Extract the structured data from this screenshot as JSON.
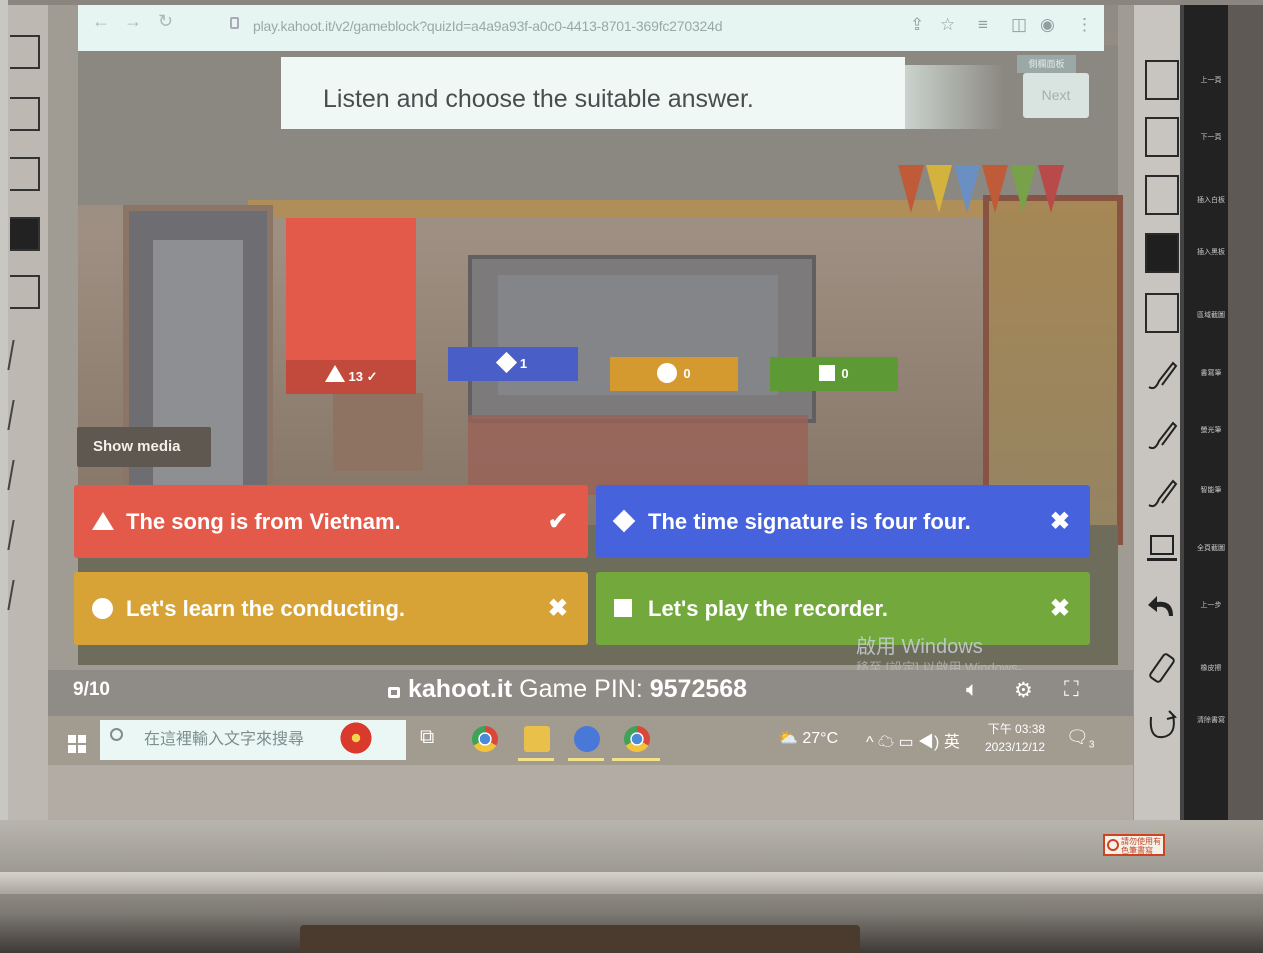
{
  "browser": {
    "url": "play.kahoot.it/v2/gameblock?quizId=a4a9a93f-a0c0-4413-8701-369fc270324d",
    "tooltip": "側欄面板"
  },
  "question": {
    "text": "Listen and choose the suitable answer.",
    "next_label": "Next"
  },
  "results": [
    {
      "shape": "triangle-icon",
      "color": "#e35a4a",
      "count": "13",
      "correct": true
    },
    {
      "shape": "diamond-icon",
      "color": "#4a5ec8",
      "count": "1",
      "correct": false
    },
    {
      "shape": "circle-icon",
      "color": "#d49a30",
      "count": "0",
      "correct": false
    },
    {
      "shape": "square-icon",
      "color": "#5d9a35",
      "count": "0",
      "correct": false
    }
  ],
  "show_media_label": "Show media",
  "answers": [
    {
      "text": "The song is from Vietnam.",
      "mark": "✔",
      "color": "#e35a4a"
    },
    {
      "text": "The time signature is four four.",
      "mark": "✖",
      "color": "#4762dd"
    },
    {
      "text": "Let's learn the conducting.",
      "mark": "✖",
      "color": "#d8a336"
    },
    {
      "text": "Let's play the recorder.",
      "mark": "✖",
      "color": "#73a93c"
    }
  ],
  "footer": {
    "question_counter": "9/10",
    "brand": "kahoot.it",
    "pin_label": "Game PIN:",
    "pin": "9572568"
  },
  "watermark": {
    "line1": "啟用 Windows",
    "line2": "移至 [設定] 以啟用 Windows。"
  },
  "taskbar": {
    "search_placeholder": "在這裡輸入文字來搜尋",
    "weather": "27°C",
    "ime": "英",
    "time": "下午 03:38",
    "date": "2023/12/12",
    "notifications": "3"
  },
  "board_tools": {
    "labels": [
      "上一頁",
      "下一頁",
      "插入白板",
      "插入黑板",
      "區域截圖",
      "書寫筆",
      "螢光筆",
      "智能筆",
      "全頁截圖",
      "上一步",
      "橡皮擦",
      "清除書寫"
    ]
  },
  "sticker_text": "請勿使用有色筆書寫"
}
